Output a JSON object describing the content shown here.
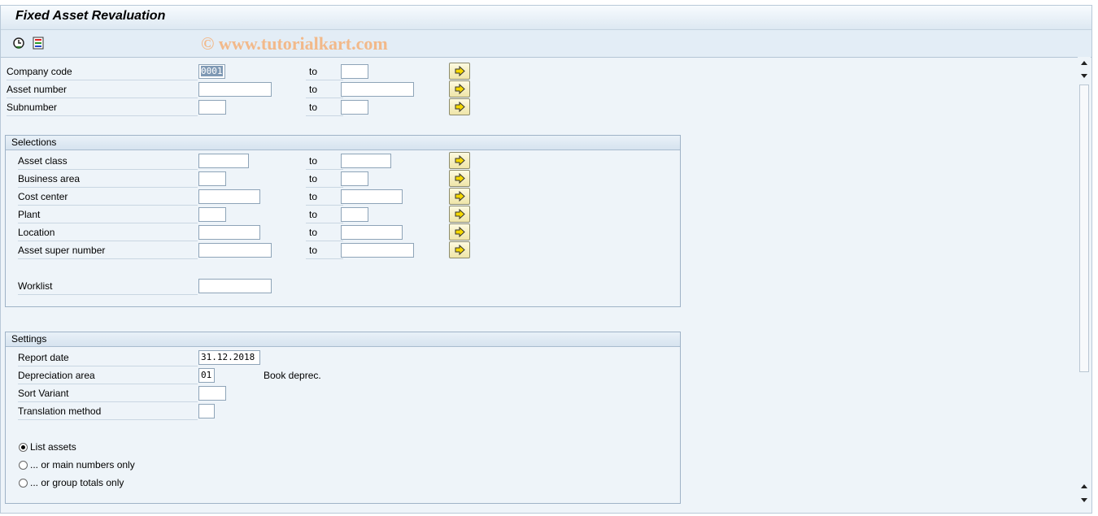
{
  "window": {
    "title": "Fixed Asset Revaluation"
  },
  "toolbar": {
    "watermark": "© www.tutorialkart.com",
    "execute_icon": "execute-clock-icon",
    "variant_icon": "selection-options-icon"
  },
  "top_fields": [
    {
      "label": "Company code",
      "from": "0001",
      "to_label": "to",
      "to": ""
    },
    {
      "label": "Asset number",
      "from": "",
      "to_label": "to",
      "to": ""
    },
    {
      "label": "Subnumber",
      "from": "",
      "to_label": "to",
      "to": ""
    }
  ],
  "selections": {
    "title": "Selections",
    "rows": [
      {
        "label": "Asset class",
        "from": "",
        "to_label": "to",
        "to": ""
      },
      {
        "label": "Business area",
        "from": "",
        "to_label": "to",
        "to": ""
      },
      {
        "label": "Cost center",
        "from": "",
        "to_label": "to",
        "to": ""
      },
      {
        "label": "Plant",
        "from": "",
        "to_label": "to",
        "to": ""
      },
      {
        "label": "Location",
        "from": "",
        "to_label": "to",
        "to": ""
      },
      {
        "label": "Asset super number",
        "from": "",
        "to_label": "to",
        "to": ""
      }
    ],
    "worklist_label": "Worklist",
    "worklist_value": ""
  },
  "settings": {
    "title": "Settings",
    "report_date_label": "Report date",
    "report_date": "31.12.2018",
    "depr_area_label": "Depreciation area",
    "depr_area": "01",
    "depr_area_text": "Book deprec.",
    "sort_variant_label": "Sort Variant",
    "sort_variant": "",
    "translation_label": "Translation method",
    "translation": "",
    "radios": [
      {
        "label": "List assets",
        "selected": true
      },
      {
        "label": "... or main numbers only",
        "selected": false
      },
      {
        "label": "... or group totals only",
        "selected": false
      }
    ]
  },
  "colors": {
    "accent": "#f2b98a",
    "background": "#eef4f9",
    "multi_btn": "#efe5a8"
  }
}
